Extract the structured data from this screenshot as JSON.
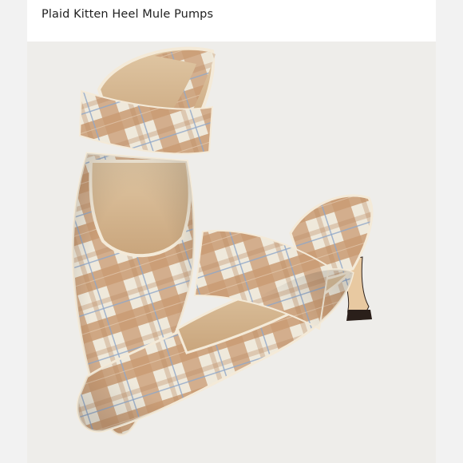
{
  "listing": {
    "title": "Plaid Kitten Heel Mule Pumps"
  },
  "photo": {
    "subject": "pair of plaid kitten heel mule pumps",
    "colors": {
      "background": "#eeedea",
      "plaid_tan": "#c99b73",
      "plaid_cream": "#efe9db",
      "plaid_blue": "#8fa6c8",
      "lining": "#d8b890",
      "piping": "#f4ead8",
      "heel_sole": "#2a1f1a"
    }
  }
}
